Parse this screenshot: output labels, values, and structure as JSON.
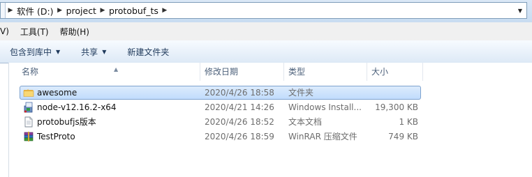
{
  "address_bar": {
    "crumbs": [
      "软件 (D:)",
      "project",
      "protobuf_ts"
    ]
  },
  "menubar": {
    "items": [
      "V)",
      "工具(T)",
      "帮助(H)"
    ]
  },
  "toolbar": {
    "include_library": "包含到库中",
    "share": "共享",
    "new_folder": "新建文件夹"
  },
  "columns": {
    "name": "名称",
    "date": "修改日期",
    "type": "类型",
    "size": "大小"
  },
  "files": [
    {
      "name": "awesome",
      "date": "2020/4/26 18:58",
      "type": "文件夹",
      "size": "",
      "icon": "folder-icon",
      "selected": true
    },
    {
      "name": "node-v12.16.2-x64",
      "date": "2020/4/21 14:26",
      "type": "Windows Install...",
      "size": "19,300 KB",
      "icon": "msi-installer-icon",
      "selected": false
    },
    {
      "name": "protobufjs版本",
      "date": "2020/4/26 18:52",
      "type": "文本文档",
      "size": "1 KB",
      "icon": "text-document-icon",
      "selected": false
    },
    {
      "name": "TestProto",
      "date": "2020/4/26 18:59",
      "type": "WinRAR 压缩文件",
      "size": "749 KB",
      "icon": "winrar-archive-icon",
      "selected": false
    }
  ]
}
